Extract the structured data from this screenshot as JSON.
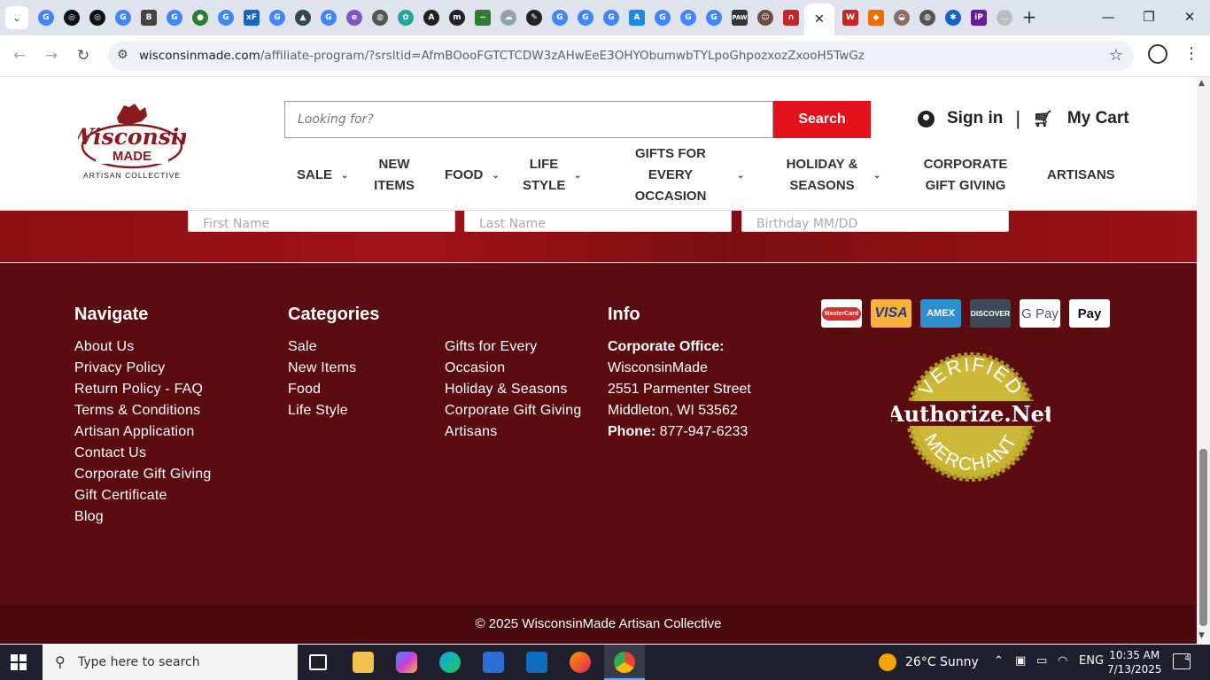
{
  "browser": {
    "url_host": "wisconsinmade.com",
    "url_path": "/affiliate-program/?srsltid=AfmBOooFGTCTCDW3zAHwEeE3OHYObumwbTYLpoGhpozxozZxooH5TwGz",
    "tab_close": "✕",
    "new_tab": "+",
    "minimize": "—",
    "maximize": "❐",
    "close": "✕"
  },
  "header": {
    "logo_line1": "Wisconsin",
    "logo_line2": "MADE",
    "logo_line3": "ARTISAN COLLECTIVE",
    "search_placeholder": "Looking for?",
    "search_button": "Search",
    "sign_in": "Sign in",
    "separator": "|",
    "cart": "My Cart"
  },
  "nav": [
    {
      "label": "SALE",
      "has_menu": true
    },
    {
      "label": "NEW ITEMS",
      "has_menu": false
    },
    {
      "label": "FOOD",
      "has_menu": true
    },
    {
      "label": "LIFE STYLE",
      "has_menu": true
    },
    {
      "label": "GIFTS FOR EVERY OCCASION",
      "has_menu": true
    },
    {
      "label": "HOLIDAY & SEASONS",
      "has_menu": true
    },
    {
      "label": "CORPORATE GIFT GIVING",
      "has_menu": false
    },
    {
      "label": "ARTISANS",
      "has_menu": false
    }
  ],
  "banner_fields": [
    "First Name",
    "Last Name",
    "Birthday MM/DD"
  ],
  "footer": {
    "navigate": {
      "heading": "Navigate",
      "links": [
        "About Us",
        "Privacy Policy",
        "Return Policy - FAQ",
        "Terms & Conditions",
        "Artisan Application",
        "Contact Us",
        "Corporate Gift Giving",
        "Gift Certificate",
        "Blog"
      ]
    },
    "categories": {
      "heading": "Categories",
      "col1": [
        "Sale",
        "New Items",
        "Food",
        "Life Style"
      ],
      "col2": [
        "Gifts for Every",
        "Occasion",
        "Holiday & Seasons",
        "Corporate Gift Giving",
        "Artisans"
      ]
    },
    "info": {
      "heading": "Info",
      "office_label": "Corporate Office:",
      "company": "WisconsinMade",
      "street": "2551 Parmenter Street",
      "city": "Middleton, WI 53562",
      "phone_label": "Phone:",
      "phone": "877-947-6233"
    },
    "payments": [
      "MasterCard",
      "VISA",
      "AMEX",
      "DISCOVER",
      "G Pay",
      " Pay"
    ],
    "seal": {
      "top": "VERIFIED",
      "middle": "Authorize.Net",
      "bottom": "MERCHANT"
    },
    "copyright": "© 2025 WisconsinMade Artisan Collective"
  },
  "taskbar": {
    "search_placeholder": "Type here to search",
    "weather": "26°C  Sunny",
    "language": "ENG",
    "time": "10:35 AM",
    "date": "7/13/2025",
    "notifications": "4"
  },
  "colors": {
    "brand_red": "#e4111a",
    "footer_bg": "#5a0c10",
    "logo_maroon": "#8b1a1e"
  }
}
